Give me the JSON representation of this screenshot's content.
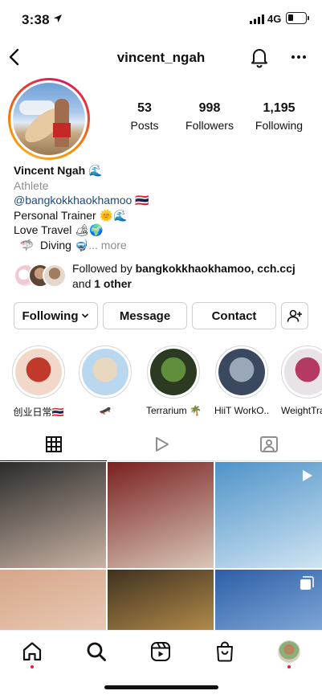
{
  "status_bar": {
    "time": "3:38",
    "network": "4G",
    "battery_level": 0.3,
    "icons": [
      "location-arrow-icon",
      "signal-bars-icon",
      "battery-icon"
    ]
  },
  "nav": {
    "title": "vincent_ngah",
    "icons": [
      "back-chevron-icon",
      "bell-icon",
      "more-dots-icon"
    ]
  },
  "stats": [
    {
      "value": "53",
      "label": "Posts"
    },
    {
      "value": "998",
      "label": "Followers"
    },
    {
      "value": "1,195",
      "label": "Following"
    }
  ],
  "bio": {
    "name": "Vincent Ngah 🌊",
    "category": "Athlete",
    "tag": "@bangkokkhaokhamoo",
    "tag_suffix": " 🇹🇭",
    "line1": "Personal Trainer 🌞🌊",
    "line2": "Love Travel 🏕🌍",
    "line3": "  🦈  Diving 🤿",
    "more": "... more"
  },
  "followed_by": {
    "prefix": "Followed by ",
    "names": "bangkokkhaokhamoo, cch.ccj",
    "middle": " and ",
    "others": "1 other"
  },
  "buttons": {
    "following": "Following",
    "message": "Message",
    "contact": "Contact"
  },
  "highlights": [
    {
      "label": "创业日常🇹🇭",
      "color_a": "#f2d8c8",
      "color_b": "#c0392b"
    },
    {
      "label": "🛹",
      "color_a": "#b9d8ef",
      "color_b": "#e8d8bf"
    },
    {
      "label": "Terrarium 🌴",
      "color_a": "#2c3a22",
      "color_b": "#5f8f3a"
    },
    {
      "label": "HiiT WorkO...",
      "color_a": "#3a4860",
      "color_b": "#9aa7b8"
    },
    {
      "label": "WeightTra",
      "color_a": "#e9e2e6",
      "color_b": "#b43a64"
    }
  ],
  "tabs": [
    "grid-icon",
    "reels-play-icon",
    "tagged-person-icon"
  ],
  "grid_posts": [
    {
      "name": "post-shirtless-portrait",
      "a": "#2b2b2b",
      "b": "#c9b3a4"
    },
    {
      "name": "post-product-packs",
      "a": "#7a2020",
      "b": "#d9c7b8"
    },
    {
      "name": "post-surfing-video",
      "a": "#4f93c9",
      "b": "#cfe4f2",
      "video": true
    },
    {
      "name": "post-closeup-face",
      "a": "#d7a68a",
      "b": "#f1d9c7"
    },
    {
      "name": "post-sunset-field",
      "a": "#3f3120",
      "b": "#e5b35c"
    },
    {
      "name": "post-blue-sky-clip",
      "a": "#2c5ea6",
      "b": "#a5c7ef",
      "multi": true
    }
  ],
  "bottom_nav": [
    "home-icon",
    "search-icon",
    "reels-icon",
    "shop-icon",
    "profile-avatar-icon"
  ]
}
